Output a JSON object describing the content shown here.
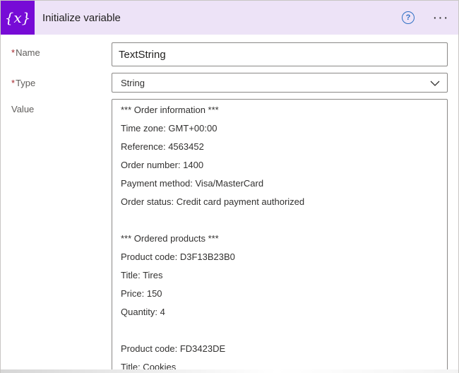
{
  "header": {
    "title": "Initialize variable",
    "icon": "variable-icon",
    "icon_glyph": "{x}",
    "icon_color": "#770bd6",
    "header_bg": "#ede3f7",
    "help_glyph": "?",
    "more_glyph": "···"
  },
  "fields": {
    "name": {
      "label": "Name",
      "required_mark": "*",
      "value": "TextString"
    },
    "type": {
      "label": "Type",
      "required_mark": "*",
      "value": "String"
    },
    "value": {
      "label": "Value",
      "lines": [
        "*** Order information ***",
        "Time zone: GMT+00:00",
        "Reference: 4563452",
        "Order number: 1400",
        "Payment method: Visa/MasterCard",
        "Order status: Credit card payment authorized",
        "",
        "*** Ordered products ***",
        "Product code: D3F13B23B0",
        "Title: Tires",
        "Price: 150",
        "Quantity: 4",
        "",
        "Product code: FD3423DE",
        "Title: Cookies"
      ]
    }
  }
}
